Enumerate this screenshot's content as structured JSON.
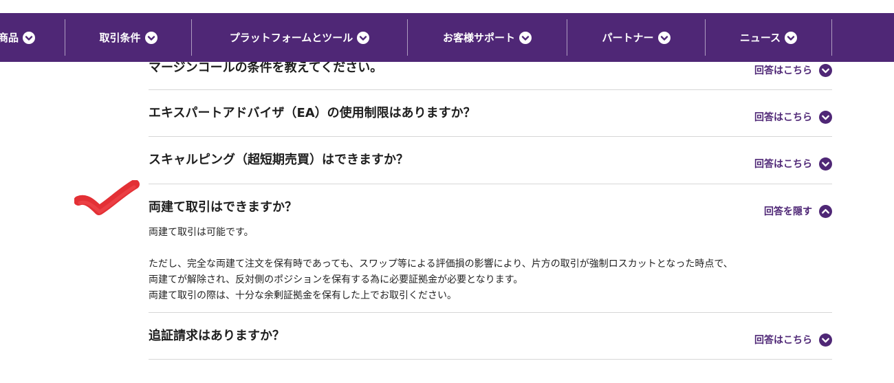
{
  "nav": {
    "items": [
      {
        "label": "商品"
      },
      {
        "label": "取引条件"
      },
      {
        "label": "プラットフォームとツール"
      },
      {
        "label": "お客様サポート"
      },
      {
        "label": "パートナー"
      },
      {
        "label": "ニュース"
      }
    ]
  },
  "faq": {
    "items": [
      {
        "question": "マージンコールの条件を教えてください。",
        "toggle": "回答はこちら"
      },
      {
        "question": "エキスパートアドバイザ（EA）の使用制限はありますか？",
        "toggle": "回答はこちら"
      },
      {
        "question": "スキャルピング（超短期売買）はできますか？",
        "toggle": "回答はこちら"
      },
      {
        "question": "両建て取引はできますか？",
        "toggle": "回答を隠す",
        "answer": [
          "両建て取引は可能です。",
          "ただし、完全な両建て注文を保有時であっても、スワップ等による評価損の影響により、片方の取引が強制ロスカットとなった時点で、",
          "両建てが解除され、反対側のポジションを保有する為に必要証拠金が必要となります。",
          "両建て取引の際は、十分な余剰証拠金を保有した上でお取引ください。"
        ]
      },
      {
        "question": "追証請求はありますか？",
        "toggle": "回答はこちら"
      }
    ]
  },
  "colors": {
    "brand": "#4f2776",
    "annotation": "#e0191f"
  }
}
